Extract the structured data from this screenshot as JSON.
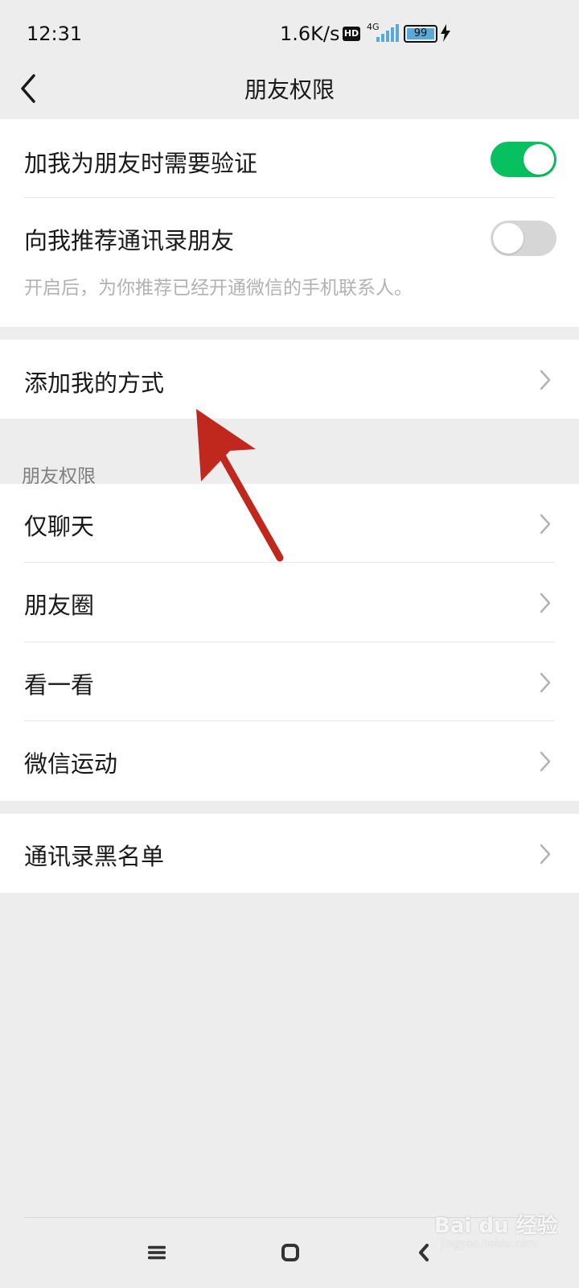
{
  "status_bar": {
    "time": "12:31",
    "net_speed": "1.6K/s",
    "hd_badge": "HD",
    "network": "4G",
    "battery": "99"
  },
  "nav": {
    "title": "朋友权限",
    "back_icon": "chevron-left-icon"
  },
  "verification_group": {
    "require_verify_label": "加我为朋友时需要验证",
    "require_verify_on": true,
    "recommend_contacts_label": "向我推荐通讯录朋友",
    "recommend_contacts_on": false,
    "recommend_hint": "开启后，为你推荐已经开通微信的手机联系人。"
  },
  "add_methods": {
    "label": "添加我的方式"
  },
  "friend_permissions": {
    "header": "朋友权限",
    "items": [
      {
        "label": "仅聊天"
      },
      {
        "label": "朋友圈"
      },
      {
        "label": "看一看"
      },
      {
        "label": "微信运动"
      }
    ]
  },
  "blacklist": {
    "label": "通讯录黑名单"
  },
  "colors": {
    "toggle_on": "#07c160",
    "toggle_off": "#d6d6d6",
    "background": "#ededed",
    "annotation_arrow": "#c0281e"
  },
  "watermark": {
    "text": "Bai du 经验",
    "sub": "jingyan.baidu.com"
  }
}
